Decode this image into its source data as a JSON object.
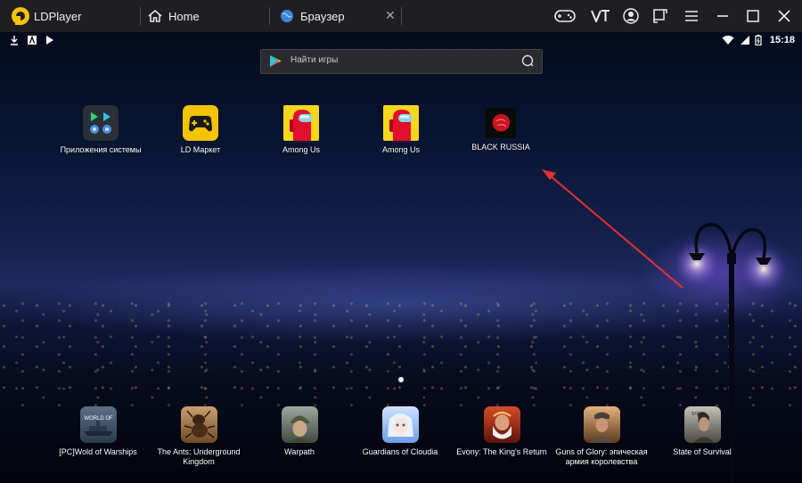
{
  "titlebar": {
    "app_name": "LDPlayer",
    "tabs": [
      {
        "label": "Home"
      },
      {
        "label": "Браузер"
      }
    ]
  },
  "statusbar": {
    "time": "15:18"
  },
  "search": {
    "placeholder": "Найти игры"
  },
  "apps": [
    {
      "label": "Приложения системы",
      "icon": "system-apps-icon"
    },
    {
      "label": "LD Маркет",
      "icon": "gamepad-icon"
    },
    {
      "label": "Among Us",
      "icon": "among-us-icon"
    },
    {
      "label": "Among Us",
      "icon": "among-us-icon"
    },
    {
      "label": "BLACK RUSSIA",
      "icon": "black-russia-icon"
    }
  ],
  "dock": [
    {
      "label": "[PC]Wold of Warships",
      "icon": "warships-icon"
    },
    {
      "label": "The Ants: Underground Kingdom",
      "icon": "ants-icon"
    },
    {
      "label": "Warpath",
      "icon": "warpath-icon"
    },
    {
      "label": "Guardians of Cloudia",
      "icon": "cloudia-icon"
    },
    {
      "label": "Evony: The King's Return",
      "icon": "evony-icon"
    },
    {
      "label": "Guns of Glory: эпическая армия королевства",
      "icon": "guns-of-glory-icon"
    },
    {
      "label": "State of Survival",
      "icon": "state-of-survival-icon"
    }
  ],
  "colors": {
    "accent": "#f5c400",
    "arrow": "#e23030",
    "titlebar": "#1f1f22"
  }
}
